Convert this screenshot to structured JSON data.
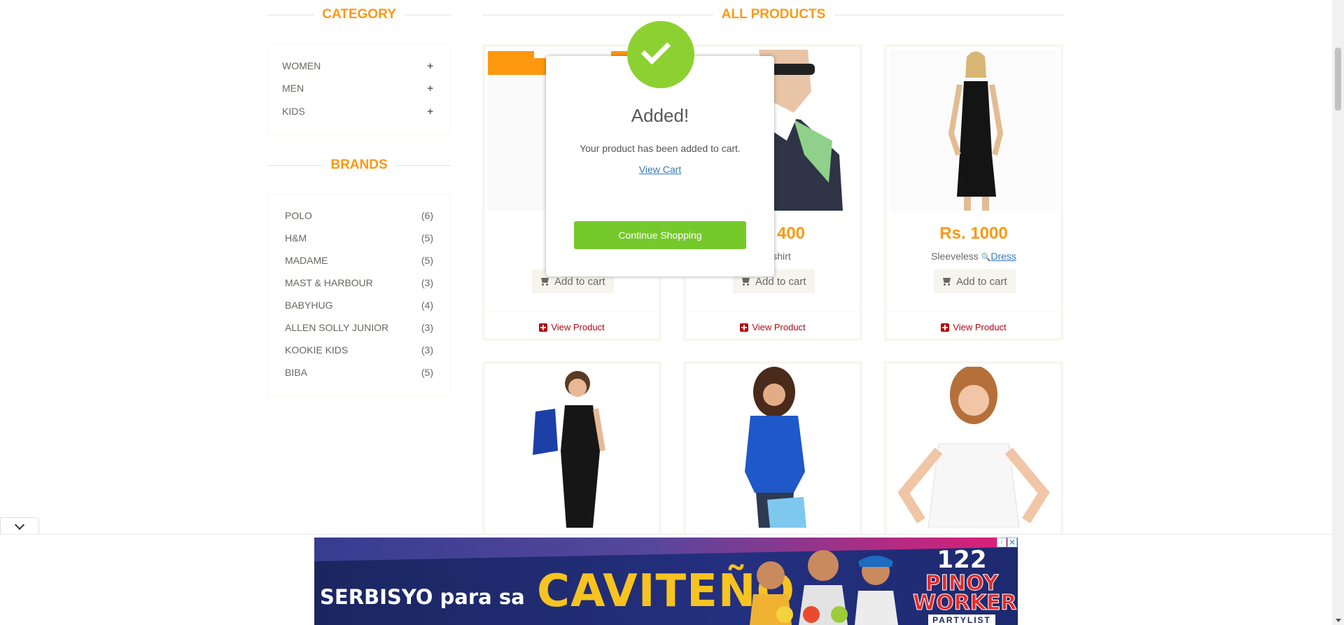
{
  "sidebar": {
    "category_title": "CATEGORY",
    "categories": [
      {
        "label": "WOMEN",
        "icon": "plus-icon"
      },
      {
        "label": "MEN",
        "icon": "plus-icon"
      },
      {
        "label": "KIDS",
        "icon": "plus-icon"
      }
    ],
    "brands_title": "BRANDS",
    "brands": [
      {
        "label": "POLO",
        "count": "(6)"
      },
      {
        "label": "H&M",
        "count": "(5)"
      },
      {
        "label": "MADAME",
        "count": "(5)"
      },
      {
        "label": "MAST & HARBOUR",
        "count": "(3)"
      },
      {
        "label": "BABYHUG",
        "count": "(4)"
      },
      {
        "label": "ALLEN SOLLY JUNIOR",
        "count": "(3)"
      },
      {
        "label": "KOOKIE KIDS",
        "count": "(3)"
      },
      {
        "label": "BIBA",
        "count": "(5)"
      }
    ]
  },
  "main": {
    "title": "ALL PRODUCTS",
    "products": [
      {
        "price": "",
        "name": "",
        "add_label": "Add to cart",
        "view_label": "View Product"
      },
      {
        "price": "400",
        "name": "Tshirt",
        "add_label": "Add to cart",
        "view_label": "View Product"
      },
      {
        "price": "Rs. 1000",
        "name_prefix": "Sleeveless",
        "name_link": "Dress",
        "add_label": "Add to cart",
        "view_label": "View Product"
      }
    ]
  },
  "modal": {
    "title": "Added!",
    "message": "Your product has been added to cart.",
    "link": "View Cart",
    "button": "Continue Shopping"
  },
  "ad": {
    "text_left": "SERBISYO para sa",
    "text_big": "CAVITEÑO",
    "logo_number": "122",
    "logo_line1": "PINOY",
    "logo_line2": "WORKERS",
    "logo_line3": "PARTYLIST"
  },
  "colors": {
    "accent": "#fe980f",
    "view_product": "#b4070f",
    "modal_button": "#76c92d",
    "check_circle": "#8cd131"
  }
}
